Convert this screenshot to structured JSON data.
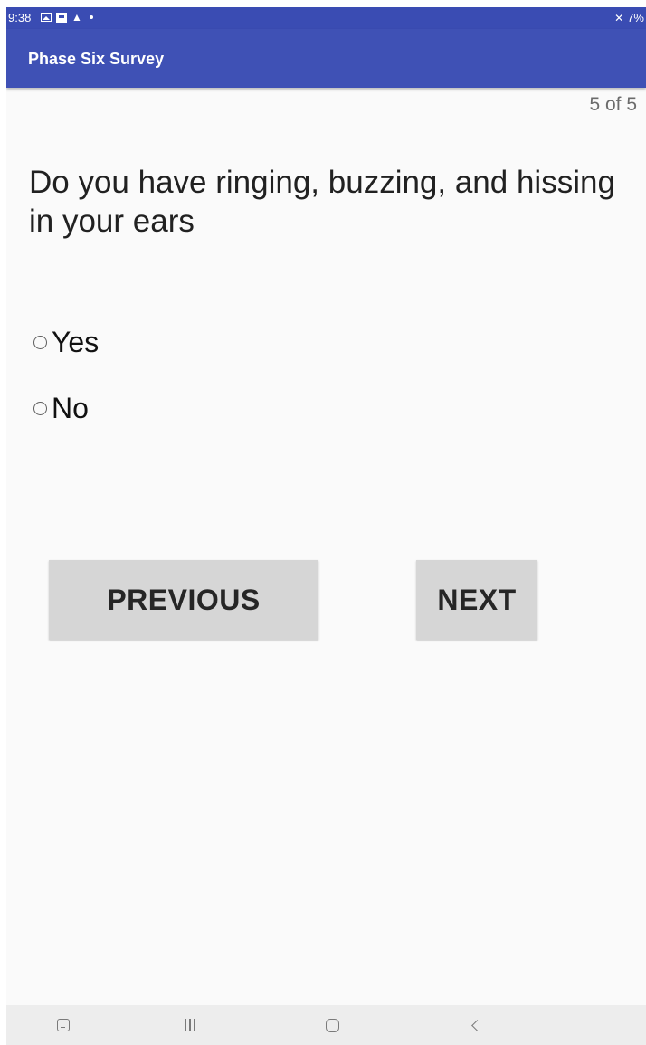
{
  "status_bar": {
    "time": "9:38",
    "battery": "7%",
    "icons": [
      "gallery-icon",
      "notification-icon",
      "warning-icon",
      "dot-icon",
      "mute-icon"
    ]
  },
  "app_bar": {
    "title": "Phase Six Survey",
    "color": "#3f51b5"
  },
  "survey": {
    "progress": "5 of 5",
    "question": "Do you have ringing, buzzing, and hissing in your ears",
    "options": [
      {
        "label": "Yes",
        "selected": false
      },
      {
        "label": "No",
        "selected": false
      }
    ]
  },
  "buttons": {
    "previous": "PREVIOUS",
    "next": "NEXT"
  },
  "nav_bar": {
    "icons": [
      "screenshot-icon",
      "recent-apps-icon",
      "home-icon",
      "back-icon"
    ]
  }
}
